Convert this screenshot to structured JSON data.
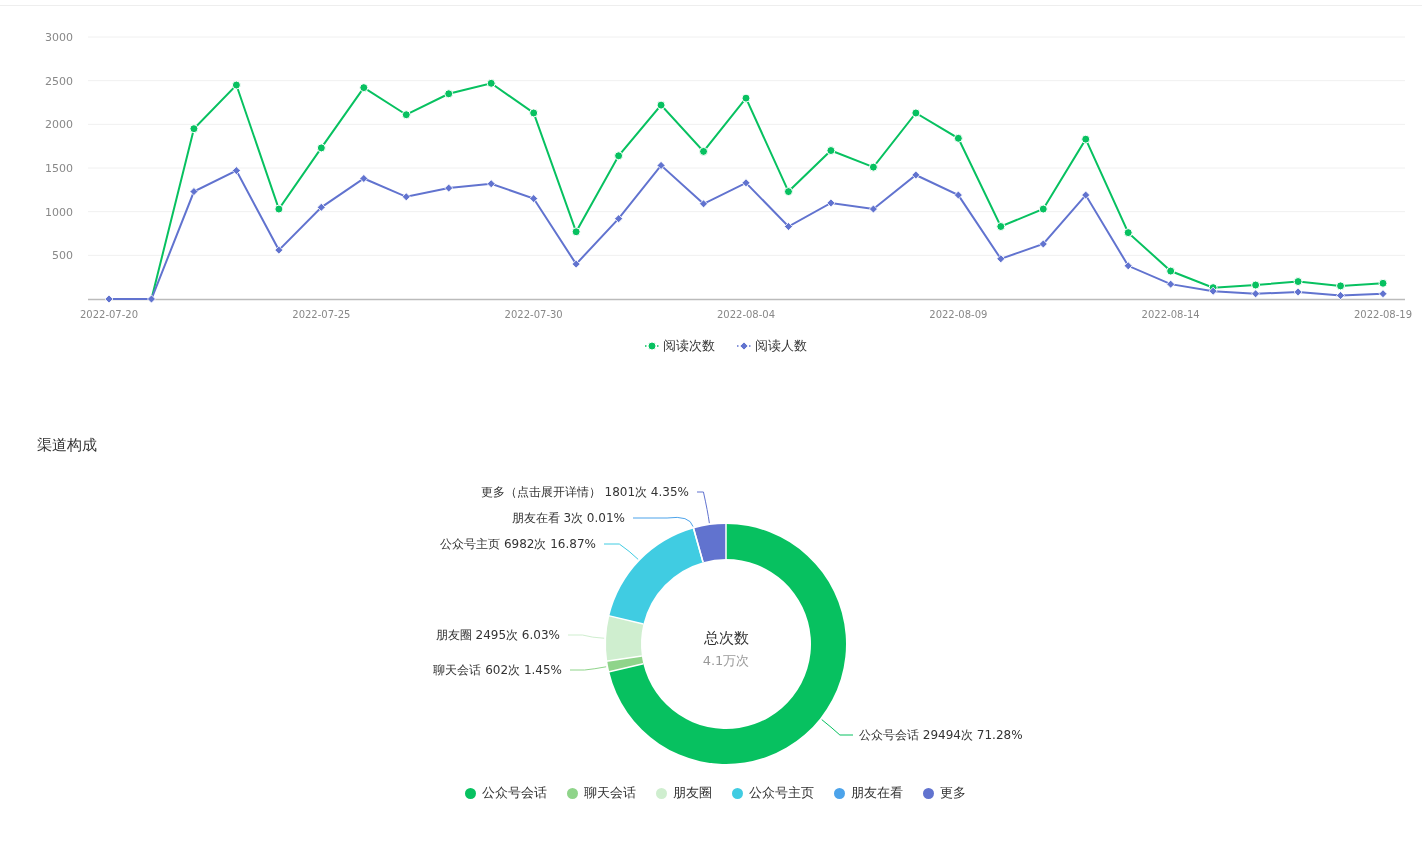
{
  "trend": {
    "chart_data": {
      "type": "line",
      "categories": [
        "2022-07-20",
        null,
        null,
        null,
        null,
        "2022-07-25",
        null,
        null,
        null,
        null,
        "2022-07-30",
        null,
        null,
        null,
        null,
        "2022-08-04",
        null,
        null,
        null,
        null,
        "2022-08-09",
        null,
        null,
        null,
        null,
        "2022-08-14",
        null,
        null,
        null,
        null,
        "2022-08-19"
      ],
      "yticks": [
        500,
        1000,
        1500,
        2000,
        2500,
        3000
      ],
      "ylim": [
        0,
        3000
      ],
      "grid": true,
      "series": [
        {
          "name": "阅读次数",
          "color": "#07c160",
          "marker": "circle",
          "values": [
            0,
            0,
            1950,
            2450,
            1030,
            1730,
            2420,
            2110,
            2350,
            2470,
            2130,
            770,
            1640,
            2220,
            1690,
            2300,
            1230,
            1700,
            1510,
            2130,
            1840,
            830,
            1030,
            1830,
            760,
            320,
            130,
            160,
            200,
            150,
            180
          ]
        },
        {
          "name": "阅读人数",
          "color": "#6173cf",
          "marker": "diamond",
          "values": [
            0,
            0,
            1230,
            1470,
            560,
            1050,
            1380,
            1170,
            1270,
            1320,
            1150,
            400,
            920,
            1530,
            1090,
            1330,
            830,
            1100,
            1030,
            1420,
            1190,
            460,
            630,
            1190,
            380,
            170,
            90,
            60,
            80,
            40,
            60
          ]
        }
      ]
    }
  },
  "channels": {
    "title": "渠道构成",
    "center_title": "总次数",
    "center_value": "4.1万次",
    "chart_data": {
      "type": "donut",
      "categories": [
        "公众号会话",
        "聊天会话",
        "朋友圈",
        "公众号主页",
        "朋友在看",
        "更多（点击展开详情）"
      ],
      "values": [
        29494,
        602,
        2495,
        6982,
        3,
        1801
      ],
      "value_labels": [
        "29494次 71.28%",
        "602次 1.45%",
        "2495次 6.03%",
        "6982次 16.87%",
        "3次 0.01%",
        "1801次 4.35%"
      ]
    },
    "legend": [
      {
        "label": "公众号会话",
        "color": "#07c160"
      },
      {
        "label": "聊天会话",
        "color": "#8fd48a"
      },
      {
        "label": "朋友圈",
        "color": "#cfeecf"
      },
      {
        "label": "公众号主页",
        "color": "#40cce2"
      },
      {
        "label": "朋友在看",
        "color": "#4ca3ea"
      },
      {
        "label": "更多",
        "color": "#6173cf"
      }
    ]
  }
}
